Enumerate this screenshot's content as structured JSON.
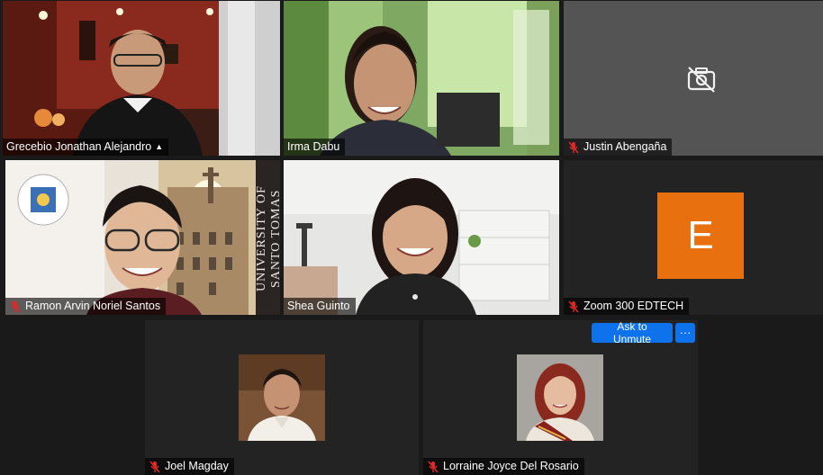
{
  "participants": [
    {
      "name": "Grecebio Jonathan Alejandro",
      "muted": false,
      "active_speaker": true
    },
    {
      "name": "Irma Dabu",
      "muted": false
    },
    {
      "name": "Justin Abengaña",
      "muted": true,
      "video": "off"
    },
    {
      "name": "Ramon Arvin Noriel Santos",
      "muted": true,
      "background_text": "UNIVERSITY OF SANTO TOMAS"
    },
    {
      "name": "Shea Guinto",
      "muted": false
    },
    {
      "name": "Zoom 300 EDTECH",
      "muted": true,
      "avatar_letter": "E"
    },
    {
      "name": "Joel Magday",
      "muted": true
    },
    {
      "name": "Lorraine Joyce Del Rosario",
      "muted": true
    }
  ],
  "controls": {
    "ask_to_unmute": "Ask to Unmute",
    "more": "···"
  },
  "colors": {
    "active_border": "#c6e24a",
    "avatar_bg": "#e8700f",
    "button_blue": "#0e72ed",
    "mic_muted_red": "#e02828"
  }
}
